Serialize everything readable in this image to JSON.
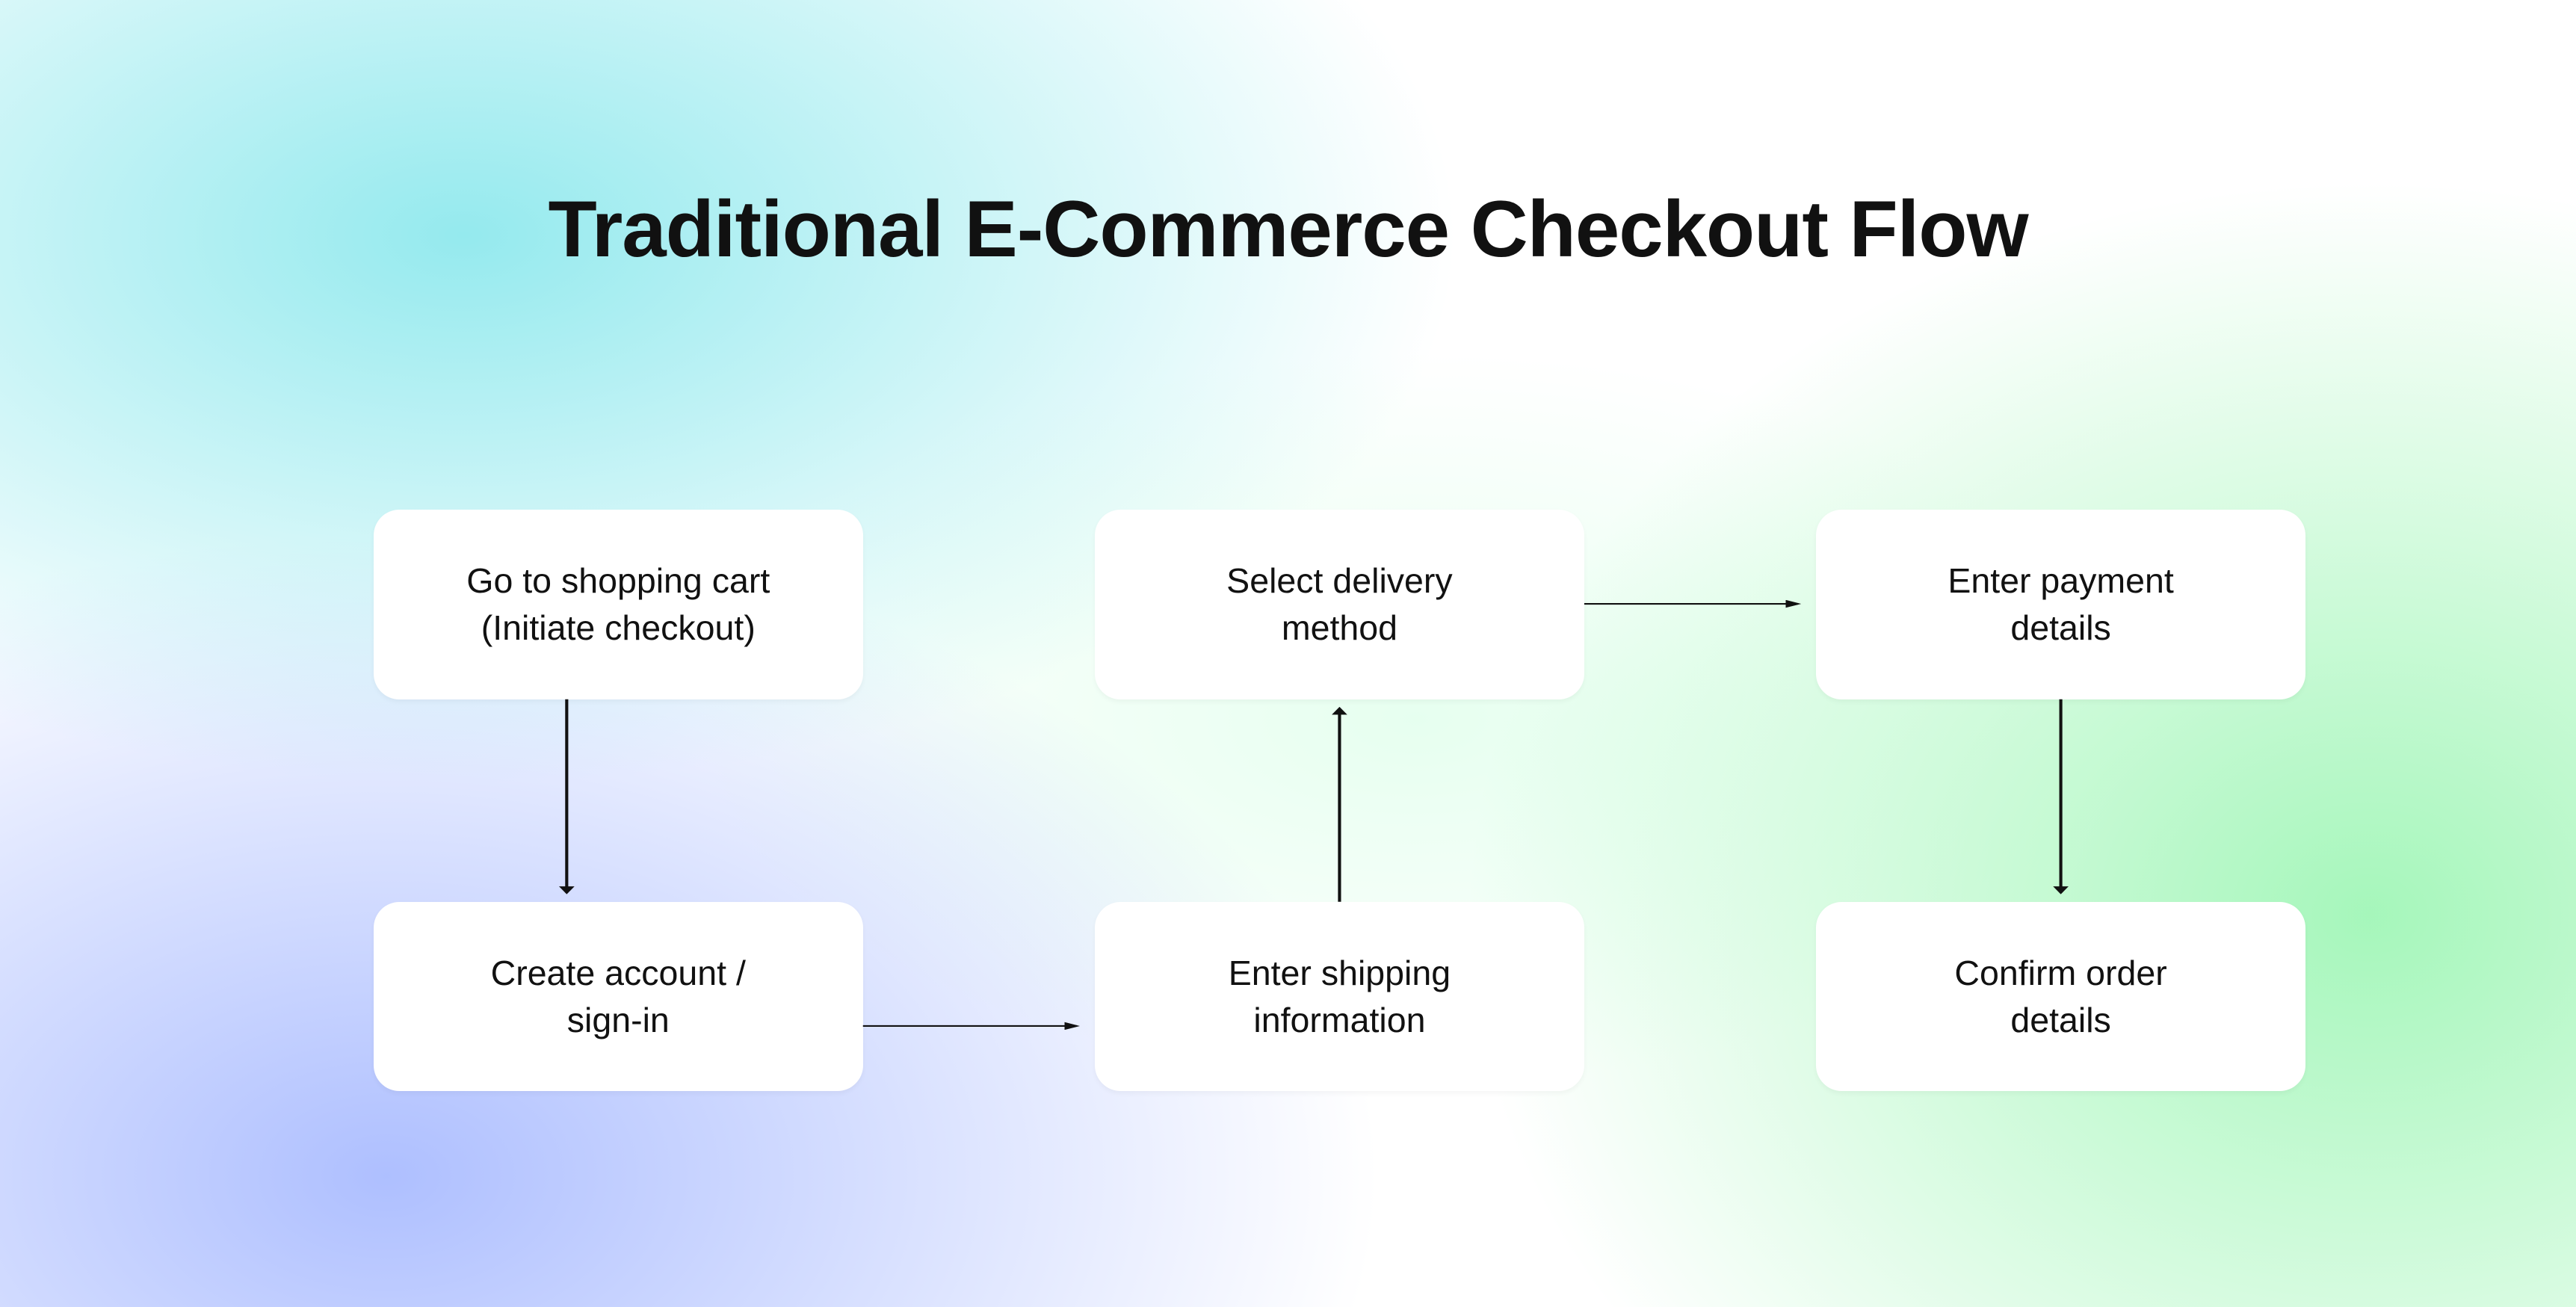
{
  "title": "Traditional E-Commerce Checkout Flow",
  "steps": {
    "s1": {
      "line1": "Go to shopping cart",
      "line2": "(Initiate checkout)"
    },
    "s2": {
      "line1": "Create account /",
      "line2": "sign-in"
    },
    "s3": {
      "line1": "Enter shipping",
      "line2": "information"
    },
    "s4": {
      "line1": "Select delivery",
      "line2": "method"
    },
    "s5": {
      "line1": "Enter payment",
      "line2": "details"
    },
    "s6": {
      "line1": "Confirm order",
      "line2": "details"
    }
  },
  "flow_edges": [
    [
      "s1",
      "s2"
    ],
    [
      "s2",
      "s3"
    ],
    [
      "s3",
      "s4"
    ],
    [
      "s4",
      "s5"
    ],
    [
      "s5",
      "s6"
    ]
  ]
}
